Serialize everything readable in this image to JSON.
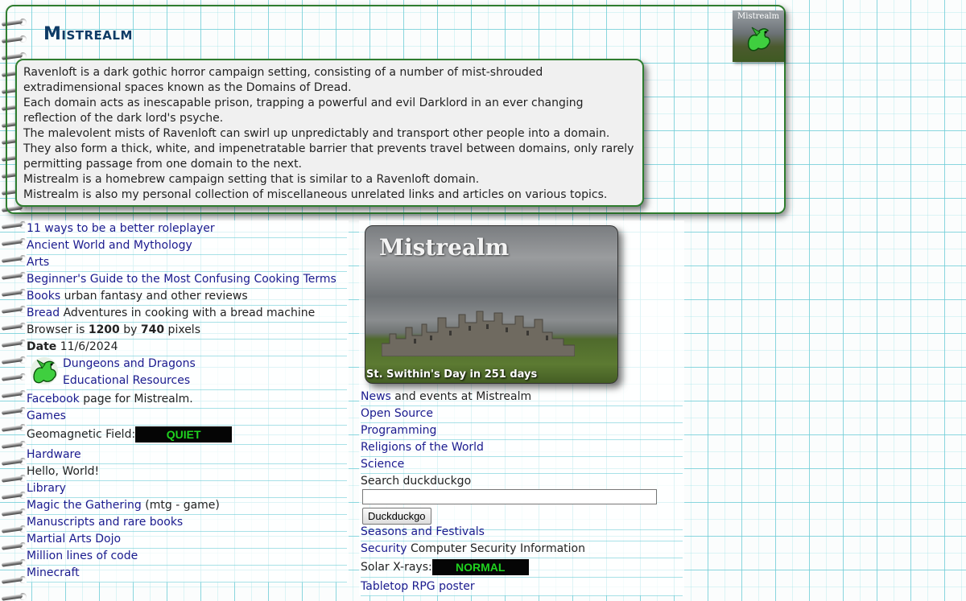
{
  "header": {
    "title": "Mistrealm",
    "logo_text": "Mistrealm",
    "intro_lines": [
      "Ravenloft is a dark gothic horror campaign setting, consisting of a number of mist-shrouded extradimensional spaces known as the Domains of Dread.",
      "Each domain acts as inescapable prison, trapping a powerful and evil Darklord in an ever changing reflection of the dark lord's psyche.",
      "The malevolent mists of Ravenloft can swirl up unpredictably and transport other people into a domain.",
      "They also form a thick, white, and impenetratable barrier that prevents travel between domains, only rarely permitting passage from one domain to the next.",
      "Mistrealm is a homebrew campaign setting that is similar to a Ravenloft domain.",
      "Mistrealm is also my personal collection of miscellaneous unrelated links and articles on various topics."
    ]
  },
  "left_column": {
    "links": [
      {
        "label": "11 ways to be a better roleplayer"
      },
      {
        "label": "Ancient World and Mythology"
      },
      {
        "label": "Arts"
      },
      {
        "label": "Beginner's Guide to the Most Confusing Cooking Terms"
      },
      {
        "label": "Books",
        "suffix": " urban fantasy and other reviews"
      },
      {
        "label": "Bread",
        "suffix": " Adventures in cooking with a bread machine"
      }
    ],
    "browser": {
      "prefix": "Browser is ",
      "width": "1200",
      "mid": " by ",
      "height": "740",
      "suffix": " pixels"
    },
    "date": {
      "label": "Date",
      "value": " 11/6/2024"
    },
    "dnd": {
      "line1": "Dungeons and Dragons",
      "line2": "Educational Resources"
    },
    "facebook": {
      "label": "Facebook",
      "suffix": " page for Mistrealm."
    },
    "games": "Games",
    "geomagnetic": {
      "label": "Geomagnetic Field:",
      "status": "QUIET"
    },
    "hardware": "Hardware",
    "hello": "Hello, World!",
    "library": "Library",
    "magic": {
      "label": "Magic the Gathering",
      "suffix": " (mtg - game)"
    },
    "manuscripts": "Manuscripts and rare books",
    "martial": "Martial Arts Dojo",
    "million": "Million lines of code",
    "minecraft": "Minecraft"
  },
  "right_column": {
    "photo": {
      "title": "Mistrealm",
      "caption": "St. Swithin's Day in 251 days"
    },
    "news": {
      "label": "News",
      "suffix": " and events at Mistrealm"
    },
    "open_source": "Open Source",
    "programming": "Programming",
    "religions": "Religions of the World",
    "science": "Science",
    "search": {
      "label": "Search duckduckgo",
      "value": "",
      "button": "Duckduckgo"
    },
    "seasons": "Seasons and Festivals",
    "security": {
      "label": "Security",
      "suffix": " Computer Security Information"
    },
    "solar": {
      "label": "Solar X-rays:",
      "status": "NORMAL"
    },
    "tabletop": "Tabletop RPG poster"
  },
  "colors": {
    "frame_green": "#2f7d2f",
    "title_blue": "#0f3b66",
    "link": "#1a1a8e",
    "status_green": "#1fd31f"
  }
}
